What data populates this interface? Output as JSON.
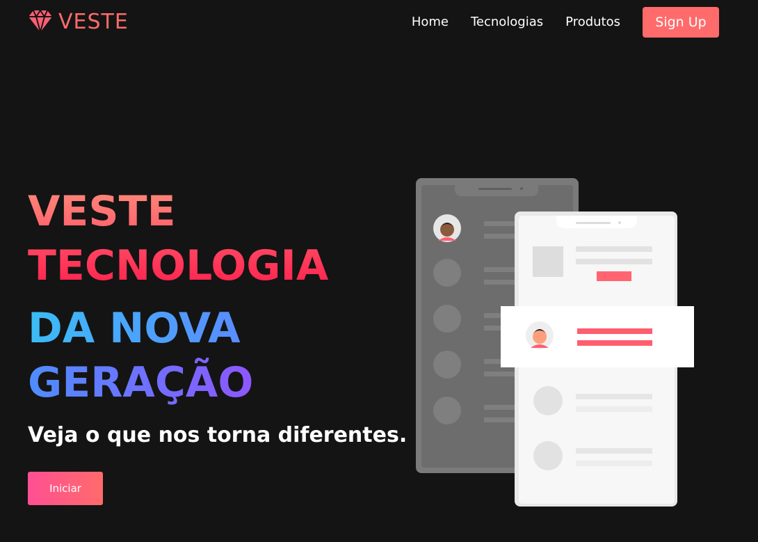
{
  "brand": {
    "name": "VESTE",
    "accent": "#ff6b6b"
  },
  "nav": {
    "links": [
      {
        "label": "Home"
      },
      {
        "label": "Tecnologias"
      },
      {
        "label": "Produtos"
      }
    ],
    "signup_label": "Sign Up"
  },
  "hero": {
    "lines": [
      "VESTE",
      "TECNOLOGIA",
      "DA NOVA",
      "GERAÇÃO"
    ],
    "subtitle": "Veja o que nos torna diferentes.",
    "cta_label": "Iniciar"
  },
  "illustration": {
    "icons": [
      "avatar-icon",
      "phone-icon"
    ]
  }
}
